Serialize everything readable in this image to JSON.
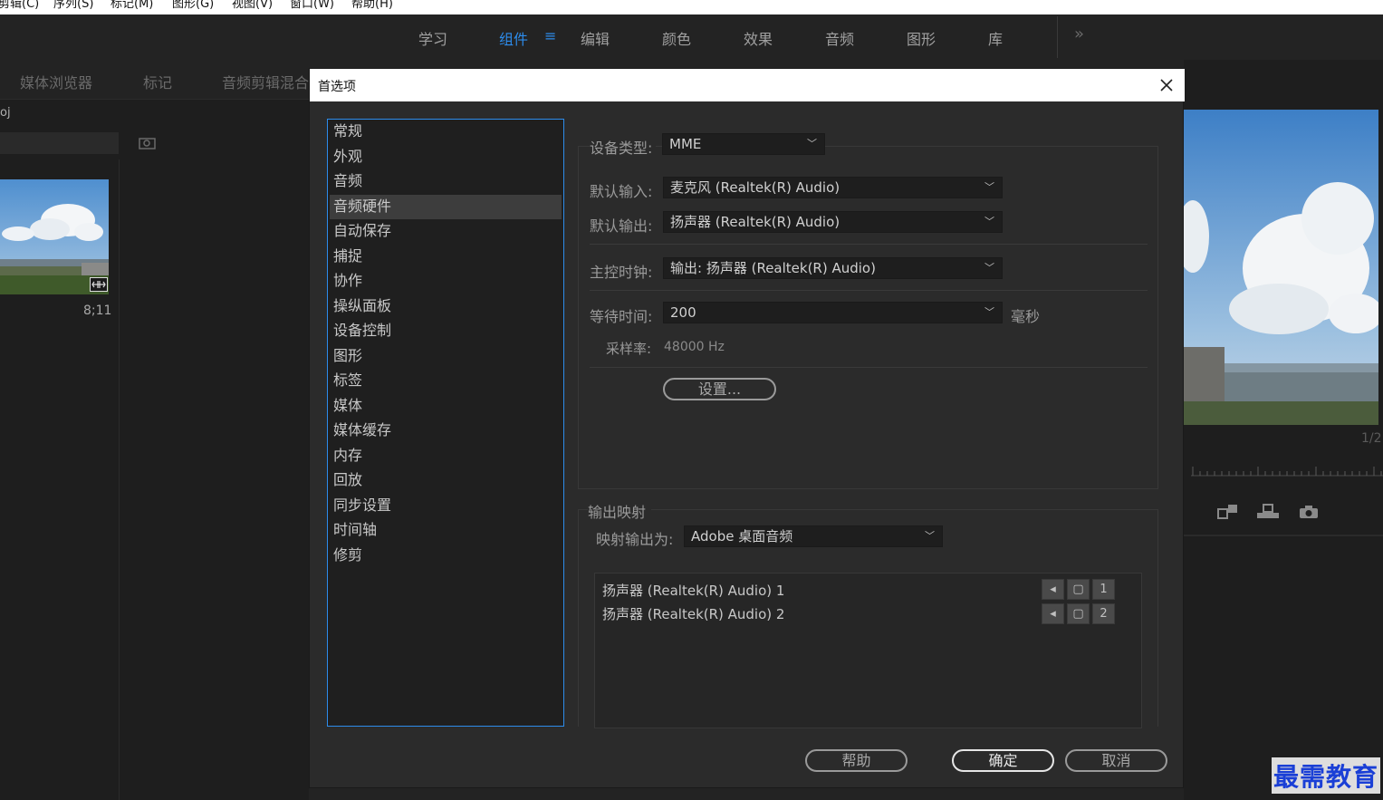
{
  "menubar": {
    "items": [
      "剪辑(C)",
      "序列(S)",
      "标记(M)",
      "图形(G)",
      "视图(V)",
      "窗口(W)",
      "帮助(H)"
    ]
  },
  "workspaces": {
    "items": [
      "学习",
      "组件",
      "编辑",
      "颜色",
      "效果",
      "音频",
      "图形",
      "库"
    ],
    "active": "组件",
    "more": "»"
  },
  "left_panel": {
    "tabs": [
      "媒体浏览器",
      "标记",
      "音频剪辑混合"
    ],
    "project_label": "oj",
    "clip_duration": "8;11"
  },
  "right_panel": {
    "page_indicator": "1/2"
  },
  "dialog": {
    "title": "首选项",
    "categories": [
      "常规",
      "外观",
      "音频",
      "音频硬件",
      "自动保存",
      "捕捉",
      "协作",
      "操纵面板",
      "设备控制",
      "图形",
      "标签",
      "媒体",
      "媒体缓存",
      "内存",
      "回放",
      "同步设置",
      "时间轴",
      "修剪"
    ],
    "selected_category": "音频硬件",
    "device_type_label": "设备类型:",
    "device_type_value": "MME",
    "default_input_label": "默认输入:",
    "default_input_value": "麦克风 (Realtek(R) Audio)",
    "default_output_label": "默认输出:",
    "default_output_value": "扬声器 (Realtek(R) Audio)",
    "master_clock_label": "主控时钟:",
    "master_clock_value": "输出: 扬声器 (Realtek(R) Audio)",
    "latency_label": "等待时间:",
    "latency_value": "200",
    "latency_unit": "毫秒",
    "sample_rate_label": "采样率:",
    "sample_rate_value": "48000 Hz",
    "settings_button": "设置...",
    "output_mapping_title": "输出映射",
    "map_output_label": "映射输出为:",
    "map_output_value": "Adobe 桌面音频",
    "mapping_rows": [
      {
        "label": "扬声器 (Realtek(R) Audio) 1",
        "channel": "1"
      },
      {
        "label": "扬声器 (Realtek(R) Audio) 2",
        "channel": "2"
      }
    ],
    "help_button": "帮助",
    "ok_button": "确定",
    "cancel_button": "取消"
  },
  "watermark": "最需教育"
}
